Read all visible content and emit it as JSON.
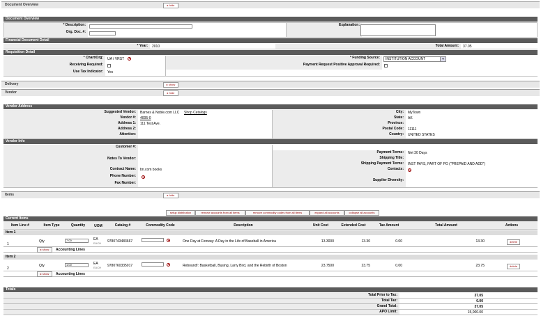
{
  "tabs": {
    "doc_overview": "Document Overview",
    "delivery": "Delivery",
    "vendor": "Vendor",
    "items": "Items",
    "hide": "▸ hide",
    "show": "▸ show"
  },
  "doc_overview": {
    "header": "Document Overview",
    "description_label": "* Description:",
    "org_doc_label": "Org. Doc. #:",
    "explanation_label": "Explanation:",
    "financial_header": "Financial Document Detail",
    "year_label": "* Year:",
    "year_value": "2010",
    "total_amount_label": "Total Amount:",
    "total_amount_value": "37.05"
  },
  "requisition": {
    "header": "Requisition Detail",
    "chart_org_label": "* Chart/Org:",
    "chart_org_value": "UA / VRST",
    "receiving_label": "Receiving Required:",
    "use_tax_label": "Use Tax Indicator:",
    "use_tax_value": "Yes",
    "funding_source_label": "* Funding Source:",
    "funding_source_value": "INSTITUTION ACCOUNT",
    "payment_req_label": "Payment Request Positive Approval Required:"
  },
  "vendor_address": {
    "header": "Vendor Address",
    "suggested_label": "Suggested Vendor:",
    "suggested_value": "Barnes & Noble.com LLC",
    "shop_catalogs": "Shop Catalogs",
    "vendor_num_label": "Vendor #:",
    "vendor_num_value": "4005-0",
    "address1_label": "Address 1:",
    "address1_value": "111 Test Ave.",
    "address2_label": "Address 2:",
    "attention_label": "Attention:",
    "city_label": "City:",
    "city_value": "MyTown",
    "state_label": "State:",
    "state_value": "AK",
    "province_label": "Province:",
    "postal_label": "Postal Code:",
    "postal_value": "11111",
    "country_label": "Country:",
    "country_value": "UNITED STATES"
  },
  "vendor_info": {
    "header": "Vendor Info",
    "customer_label": "Customer #:",
    "notes_label": "Notes To Vendor:",
    "contract_label": "Contract Name:",
    "contract_value": "bn.com books",
    "phone_label": "Phone Number:",
    "fax_label": "Fax Number:",
    "payment_terms_label": "Payment Terms:",
    "payment_terms_value": "Net 30 Days",
    "shipping_title_label": "Shipping Title:",
    "shipping_payment_label": "Shipping Payment Terms:",
    "shipping_payment_value": "INST PAYS, PART OF PO (\"PREPAID AND ADD\")",
    "contacts_label": "Contacts:",
    "supplier_diversity_label": "Supplier Diversity:"
  },
  "items": {
    "buttons": [
      "setup distribution",
      "remove accounts from all items",
      "remove commodity codes from all items",
      "expand all accounts",
      "collapse all accounts"
    ],
    "current_items_header": "Current Items",
    "columns": [
      "Item Line #",
      "Item Type",
      "Quantity",
      "UOM",
      "Catalog #",
      "Commodity Code",
      "Description",
      "Unit Cost",
      "Extended Cost",
      "Tax Amount",
      "Total Amount",
      "Actions"
    ],
    "rows": [
      {
        "header": "Item 1",
        "line": "1",
        "type": "Qty",
        "qty": "7.00",
        "uom": "EA",
        "uom_sub": "EACH",
        "catalog": "9780743483667",
        "description": "One Day at Fenway: A Day in the Life of Baseball in America",
        "unit_cost": "13.3000",
        "extended": "13.30",
        "tax": "0.00",
        "total": "13.30",
        "delete": "delete",
        "show": "▸ show",
        "accounting": "Accounting Lines"
      },
      {
        "header": "Item 2",
        "line": "2",
        "type": "Qty",
        "qty": "1.00",
        "uom": "EA",
        "uom_sub": "EACH",
        "catalog": "9780760335017",
        "description": "Rebound!: Basketball, Busing, Larry Bird, and the Rebirth of Boston",
        "unit_cost": "23.7500",
        "extended": "23.75",
        "tax": "0.00",
        "total": "23.75",
        "delete": "delete",
        "show": "▸ show",
        "accounting": "Accounting Lines"
      }
    ]
  },
  "totals": {
    "header": "Totals",
    "rows": [
      {
        "label": "Total Prior to Tax:",
        "value": "37.05"
      },
      {
        "label": "Total Tax:",
        "value": "0.00"
      },
      {
        "label": "Grand Total:",
        "value": "37.05"
      },
      {
        "label": "APO Limit:",
        "value": "15,000.00"
      }
    ]
  }
}
